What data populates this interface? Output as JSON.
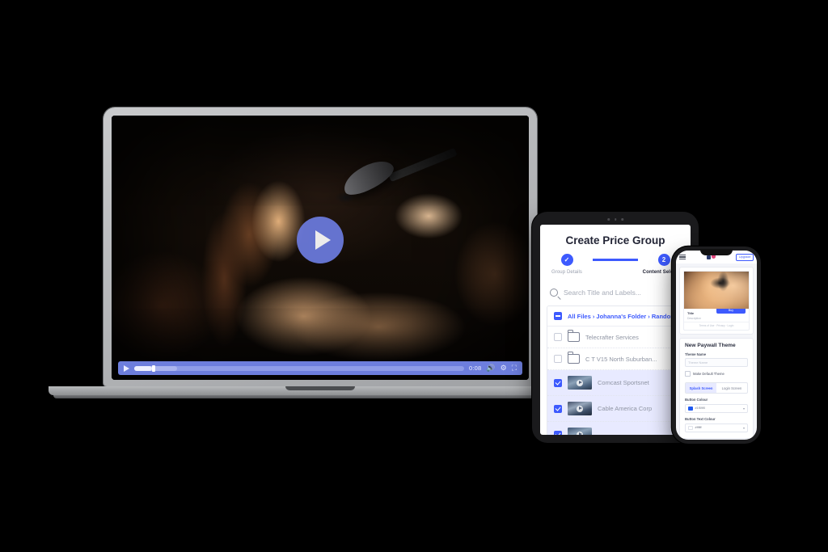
{
  "scene": {
    "background": "#000000",
    "devices": [
      "laptop",
      "tablet",
      "phone"
    ]
  },
  "laptop": {
    "device_name": "laptop-macbook",
    "player": {
      "poster_alt": "female-singer-performing-on-stage",
      "play_overlay_icon": "play-icon",
      "accent": "#6c7ce0",
      "controls": {
        "play_icon": "play-icon",
        "time": "0:08",
        "progress_percent": 5.5,
        "buffered_percent": 13,
        "volume_icon": "volume-icon",
        "settings_icon": "settings-gear-icon",
        "fullscreen_icon": "fullscreen-icon"
      }
    }
  },
  "tablet": {
    "device_name": "tablet-ipad",
    "title": "Create Price Group",
    "steps": [
      {
        "label": "Group Details",
        "state": "done",
        "marker": "✓"
      },
      {
        "label": "Content Selection",
        "state": "current",
        "marker": "2"
      }
    ],
    "search": {
      "icon": "search-icon",
      "placeholder": "Search Title and Labels..."
    },
    "breadcrumb": {
      "checkbox_state": "indeterminate",
      "parts": [
        "All Files",
        "Johanna's Folder",
        "Random"
      ],
      "separator": "›",
      "text": "All Files › Johanna's Folder › Random"
    },
    "rows": [
      {
        "type": "folder",
        "icon": "folder-icon",
        "label": "Telecrafter Services",
        "checked": false,
        "selected": false
      },
      {
        "type": "folder",
        "icon": "folder-icon",
        "label": "C T V15 North Suburban...",
        "checked": false,
        "selected": false
      },
      {
        "type": "video",
        "icon": "video-thumbnail",
        "label": "Comcast Sportsnet",
        "checked": true,
        "selected": true
      },
      {
        "type": "video",
        "icon": "video-thumbnail",
        "label": "Cable America Corp",
        "checked": true,
        "selected": true
      }
    ],
    "accent": "#3d5afe"
  },
  "phone": {
    "device_name": "phone-iphone",
    "topbar": {
      "menu_icon": "hamburger-menu-icon",
      "logo": "app-logo",
      "upgrade_label": "Upgrade"
    },
    "preview": {
      "image_alt": "female-singer-performing-on-stage",
      "title": "Title",
      "description": "Description",
      "buy_label": "Buy",
      "footer_links": "Terms of Use · Privacy · Login"
    },
    "theme_form": {
      "heading": "New Paywall Theme",
      "theme_name_label": "Theme Name",
      "theme_name_placeholder": "Theme Name",
      "theme_name_value": "",
      "default_theme_label": "Make Default Theme",
      "default_theme_checked": false,
      "tabs": [
        {
          "label": "Splash Screen",
          "active": true
        },
        {
          "label": "Login Screen",
          "active": false
        }
      ],
      "button_colour_label": "Button Colour",
      "button_colour_value": "#1f59f0",
      "button_colour_swatch": "#1f59f0",
      "button_text_colour_label": "Button Text Colour",
      "button_text_colour_value": "#ffffff",
      "button_text_colour_swatch": "#ffffff",
      "chevron_icon": "chevron-down-icon"
    },
    "accent": "#3d5afe"
  }
}
